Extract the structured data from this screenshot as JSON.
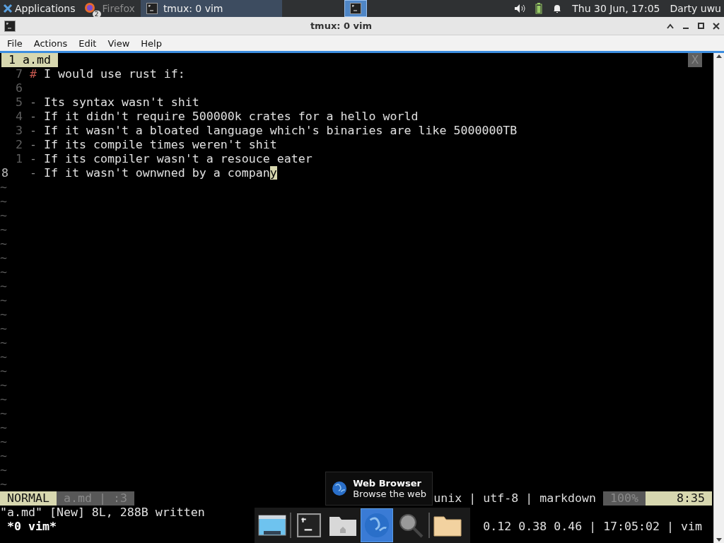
{
  "panel": {
    "apps_label": "Applications",
    "tasks": [
      {
        "label": "Firefox",
        "badge": "2",
        "kind": "firefox",
        "selected": false
      },
      {
        "label": "tmux: 0 vim",
        "kind": "terminal",
        "selected": true
      }
    ],
    "pager": [
      {
        "kind": "terminal",
        "selected": true
      }
    ],
    "clock": "Thu 30 Jun, 17:05",
    "user": "Darty uwu"
  },
  "window": {
    "title": "tmux: 0 vim",
    "menu": [
      "File",
      "Actions",
      "Edit",
      "View",
      "Help"
    ]
  },
  "vim": {
    "tab": {
      "number": "1",
      "name": "a.md"
    },
    "tab_close": "X",
    "lines": [
      {
        "number": "7",
        "marker": "#",
        "text": "I would use rust if:",
        "current": false
      },
      {
        "number": "6",
        "current": false
      },
      {
        "number": "5",
        "marker": "-",
        "text": "Its syntax wasn't shit",
        "current": false
      },
      {
        "number": "4",
        "marker": "-",
        "text": "If it didn't require 500000k crates for a hello world",
        "current": false
      },
      {
        "number": "3",
        "marker": "-",
        "text": "If it wasn't a bloated language which's binaries are like 5000000TB",
        "current": false
      },
      {
        "number": "2",
        "marker": "-",
        "text": "If its compile times weren't shit",
        "current": false
      },
      {
        "number": "1",
        "marker": "-",
        "text": "If its compiler wasn't a resouce eater",
        "current": false
      },
      {
        "number": "8",
        "marker": "-",
        "text": "If it wasn't ownwned by a company",
        "current": true
      }
    ],
    "filler": [
      "~",
      "~",
      "~",
      "~",
      "~",
      "~",
      "~",
      "~",
      "~",
      "~",
      "~",
      "~",
      "~",
      "~",
      "~",
      "~",
      "~",
      "~",
      "~",
      "~",
      "~",
      "~"
    ],
    "status": {
      "mode": "NORMAL",
      "file": "a.md | :3",
      "info": "unix | utf-8 | markdown",
      "percent": "100%",
      "position": "8:35"
    },
    "message": "\"a.md\" [New] 8L, 288B written"
  },
  "tmux": {
    "window": "*0 vim*",
    "right": "0.12 0.38 0.46 | 17:05:02 | vim"
  },
  "dock": {
    "items": [
      {
        "kind": "desktop",
        "selected": false
      },
      {
        "kind": "separator"
      },
      {
        "kind": "terminal",
        "selected": false
      },
      {
        "kind": "home-folder",
        "selected": false
      },
      {
        "kind": "browser",
        "selected": true
      },
      {
        "kind": "search",
        "selected": false
      },
      {
        "kind": "separator"
      },
      {
        "kind": "folder",
        "selected": false
      }
    ],
    "tooltip": {
      "title": "Web Browser",
      "subtitle": "Browse the web"
    }
  }
}
